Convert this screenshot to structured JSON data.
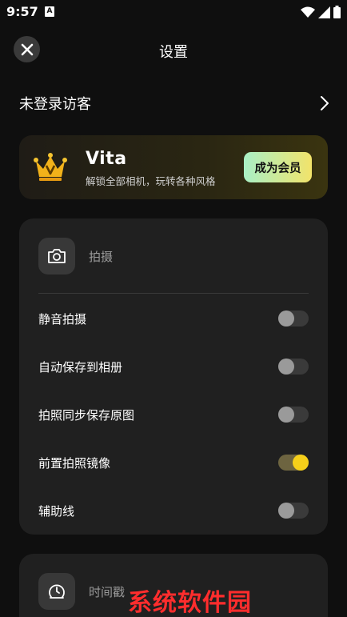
{
  "status_bar": {
    "time": "9:57",
    "notification_icon": "A",
    "icons": [
      "wifi-icon",
      "signal-icon",
      "battery-icon"
    ]
  },
  "header": {
    "title": "设置",
    "close_icon": "close-icon"
  },
  "user": {
    "name": "未登录访客",
    "chevron_icon": "chevron-right-icon"
  },
  "vip_card": {
    "title": "Vita",
    "subtitle": "解锁全部相机，玩转各种风格",
    "button_label": "成为会员",
    "crown_icon": "crown-icon",
    "button_gradient": [
      "#a9f0c6",
      "#f2e36a"
    ]
  },
  "shooting": {
    "section_label": "拍摄",
    "section_icon": "camera-icon",
    "items": [
      {
        "label": "静音拍摄",
        "on": false
      },
      {
        "label": "自动保存到相册",
        "on": false
      },
      {
        "label": "拍照同步保存原图",
        "on": false
      },
      {
        "label": "前置拍照镜像",
        "on": true
      },
      {
        "label": "辅助线",
        "on": false
      }
    ]
  },
  "timestamp": {
    "section_label": "时间戳",
    "section_icon": "clock-icon"
  },
  "watermark": "系统软件园",
  "colors": {
    "background": "#0f0f0f",
    "card": "#202020",
    "toggle_on_knob": "#f5cf1a",
    "toggle_off_knob": "#9a9a9a",
    "watermark": "#ff2d2d"
  }
}
